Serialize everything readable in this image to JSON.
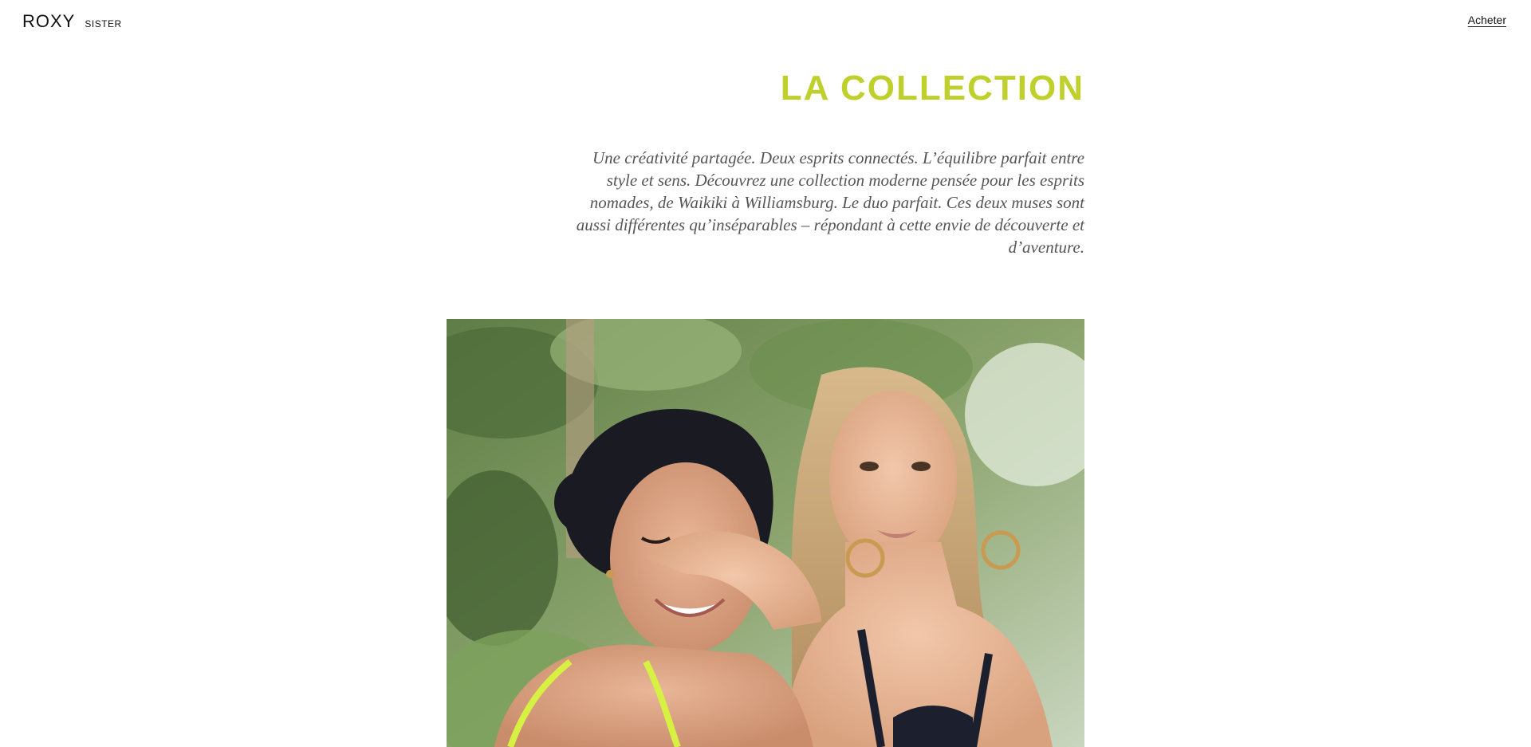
{
  "header": {
    "brand_logo": "ROXY",
    "brand_sub": "SISTER",
    "shop_link": "Acheter"
  },
  "main": {
    "title": "LA COLLECTION",
    "description": "Une créativité partagée. Deux esprits connectés. L’équilibre parfait entre style et sens. Découvrez une collection moderne pensée pour les esprits nomades, de Waikiki à Williamsburg. Le duo parfait. Ces deux muses sont aussi différentes qu’inséparables – répondant à cette envie de découverte et d’aventure."
  },
  "colors": {
    "accent": "#bfcf2b",
    "text_muted": "#555555"
  }
}
